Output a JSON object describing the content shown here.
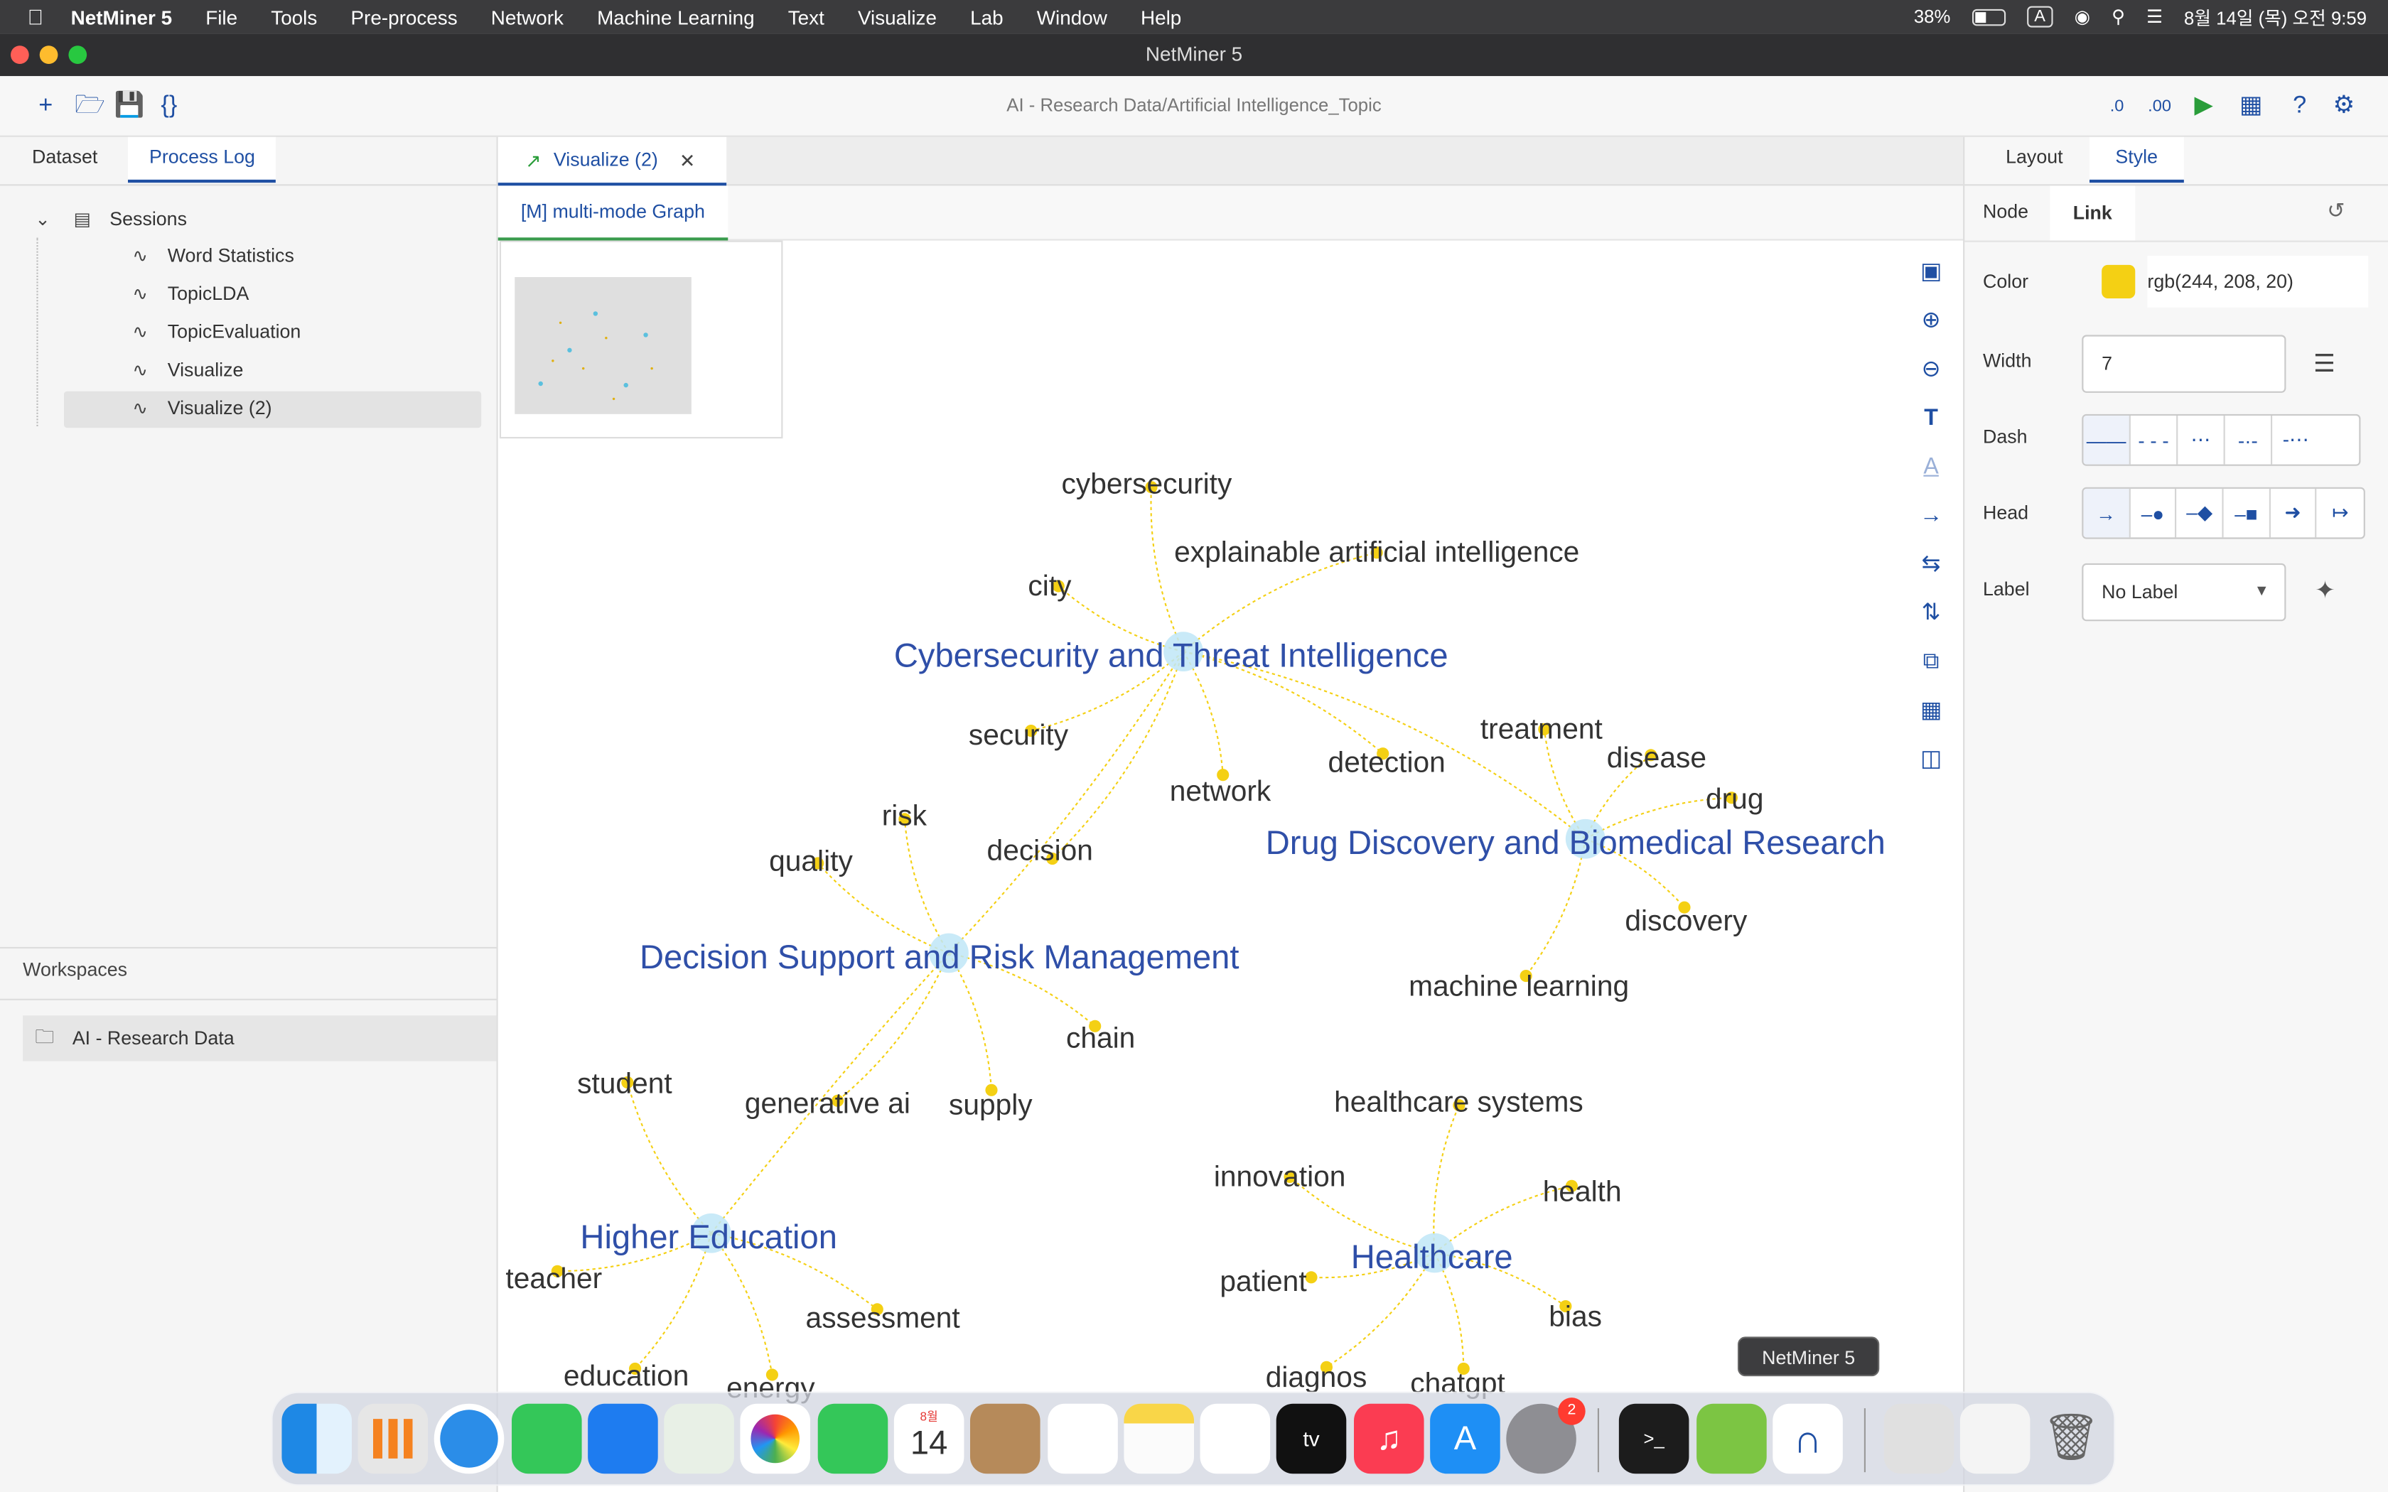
{
  "menubar": {
    "app_name": "NetMiner 5",
    "items": [
      "File",
      "Tools",
      "Pre-process",
      "Network",
      "Machine Learning",
      "Text",
      "Visualize",
      "Lab",
      "Window",
      "Help"
    ],
    "battery": "38%",
    "input_source": "A",
    "clock": "8월 14일 (목) 오전 9:59"
  },
  "window": {
    "title": "NetMiner 5",
    "path": "AI - Research Data/Artificial Intelligence_Topic"
  },
  "left_panel": {
    "tabs": [
      "Dataset",
      "Process Log"
    ],
    "active_tab": "Process Log",
    "sessions_label": "Sessions",
    "sessions": [
      "Word Statistics",
      "TopicLDA",
      "TopicEvaluation",
      "Visualize",
      "Visualize (2)"
    ],
    "selected_session": "Visualize (2)",
    "workspaces_label": "Workspaces",
    "workspace_item": "AI - Research Data"
  },
  "center": {
    "tab_label": "Visualize (2)",
    "subtab_label": "[M] multi-mode Graph"
  },
  "graph": {
    "topics": [
      {
        "id": "t1",
        "label": "Cybersecurity and Threat Intelligence"
      },
      {
        "id": "t2",
        "label": "Drug Discovery and Biomedical Research"
      },
      {
        "id": "t3",
        "label": "Decision Support and Risk Management"
      },
      {
        "id": "t4",
        "label": "Higher Education"
      },
      {
        "id": "t5",
        "label": "Healthcare"
      }
    ],
    "words": [
      {
        "label": "cybersecurity",
        "topic": "t1"
      },
      {
        "label": "explainable artificial intelligence",
        "topic": "t1"
      },
      {
        "label": "city",
        "topic": "t1"
      },
      {
        "label": "security",
        "topic": "t1"
      },
      {
        "label": "network",
        "topic": "t1"
      },
      {
        "label": "detection",
        "topic": "t1"
      },
      {
        "label": "decision",
        "topic": "t1"
      },
      {
        "label": "treatment",
        "topic": "t2"
      },
      {
        "label": "disease",
        "topic": "t2"
      },
      {
        "label": "drug",
        "topic": "t2"
      },
      {
        "label": "discovery",
        "topic": "t2"
      },
      {
        "label": "machine learning",
        "topic": "t2"
      },
      {
        "label": "risk",
        "topic": "t3"
      },
      {
        "label": "quality",
        "topic": "t3"
      },
      {
        "label": "chain",
        "topic": "t3"
      },
      {
        "label": "supply",
        "topic": "t3"
      },
      {
        "label": "generative ai",
        "topic": "t3"
      },
      {
        "label": "student",
        "topic": "t4"
      },
      {
        "label": "teacher",
        "topic": "t4"
      },
      {
        "label": "assessment",
        "topic": "t4"
      },
      {
        "label": "education",
        "topic": "t4"
      },
      {
        "label": "energy",
        "topic": "t4"
      },
      {
        "label": "healthcare systems",
        "topic": "t5"
      },
      {
        "label": "innovation",
        "topic": "t5"
      },
      {
        "label": "health",
        "topic": "t5"
      },
      {
        "label": "patient",
        "topic": "t5"
      },
      {
        "label": "bias",
        "topic": "t5"
      },
      {
        "label": "diagnos",
        "topic": "t5"
      },
      {
        "label": "chatgpt",
        "topic": "t5"
      }
    ],
    "link_color": "#f4d014",
    "topic_node_color": "#bfe6f7",
    "word_node_color": "#f4d014"
  },
  "style_panel": {
    "tabs": [
      "Layout",
      "Style"
    ],
    "active_tab": "Style",
    "subtabs": [
      "Node",
      "Link"
    ],
    "active_subtab": "Link",
    "color_label": "Color",
    "color_value": "rgb(244, 208, 20)",
    "swatch_color": "#f4d014",
    "width_label": "Width",
    "width_value": "7",
    "dash_label": "Dash",
    "head_label": "Head",
    "label_label": "Label",
    "label_value": "No Label"
  },
  "dock": {
    "tooltip": "NetMiner 5",
    "calendar_month": "8월",
    "calendar_day": "14",
    "badge_count": "2"
  }
}
